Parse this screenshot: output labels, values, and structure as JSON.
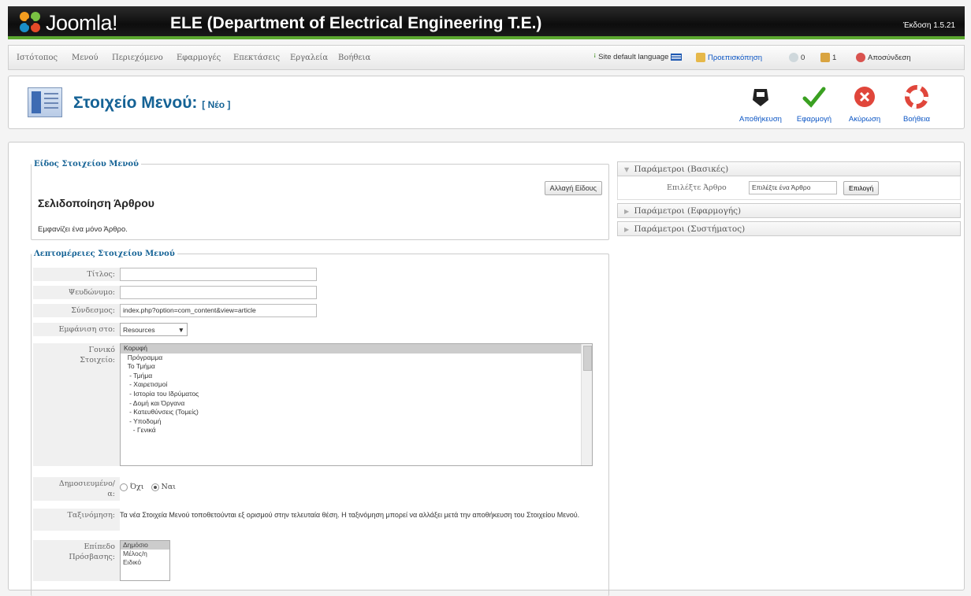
{
  "header": {
    "logo_text": "Joomla!",
    "site_title": "ELE (Department of Electrical Engineering T.E.)",
    "version": "Έκδοση 1.5.21"
  },
  "menu": {
    "items": [
      "Ιστότοπος",
      "Μενού",
      "Περιεχόμενο",
      "Εφαρμογές",
      "Επεκτάσεις",
      "Εργαλεία",
      "Βοήθεια"
    ],
    "site_default_language": "Site default language",
    "preview": "Προεπισκόπηση",
    "messages_count": "0",
    "users_count": "1",
    "logout": "Αποσύνδεση"
  },
  "toolbar": {
    "title": "Στοιχείο Μενού:",
    "subtitle": "[ Νέο ]",
    "save": "Αποθήκευση",
    "apply": "Εφαρμογή",
    "cancel": "Ακύρωση",
    "help": "Βοήθεια"
  },
  "type_box": {
    "legend": "Είδος Στοιχείου Μενού",
    "name": "Σελιδοποίηση Άρθρου",
    "description": "Εμφανίζει ένα μόνο Άρθρο.",
    "change_button": "Αλλαγή Είδους"
  },
  "details": {
    "legend": "Λεπτομέρειες Στοιχείου Μενού",
    "title_label": "Τίτλος:",
    "title_value": "",
    "alias_label": "Ψευδώνυμο:",
    "alias_value": "",
    "link_label": "Σύνδεσμος:",
    "link_value": "index.php?option=com_content&view=article",
    "display_in_label": "Εμφάνιση στο:",
    "display_in_value": "Resources",
    "parent_label_1": "Γονικό",
    "parent_label_2": "Στοιχείο:",
    "parent_items": [
      "Κορυφή",
      "  Πρόγραμμα",
      "  Το Τμήμα",
      "   - Τμήμα",
      "   - Χαιρετισμοί",
      "   - Ιστορία του Ιδρύματος",
      "   - Δομή και Όργανα",
      "   - Κατευθύνσεις (Τομείς)",
      "   - Υποδομή",
      "     - Γενικά"
    ],
    "published_label_1": "Δημοσιευμένο/",
    "published_label_2": "α:",
    "published_no": "Όχι",
    "published_yes": "Ναι",
    "order_label": "Ταξινόμηση:",
    "order_text": "Τα νέα Στοιχεία Μενού τοποθετούνται εξ ορισμού στην τελευταία θέση. Η ταξινόμηση μπορεί να αλλάξει μετά την αποθήκευση του Στοιχείου Μενού.",
    "access_label_1": "Επίπεδο",
    "access_label_2": "Πρόσβασης:",
    "access_items": [
      "Δημόσιο",
      "Μέλος/η",
      "Ειδικό"
    ]
  },
  "params": {
    "basic": "Παράμετροι (Βασικές)",
    "select_article_label": "Επιλέξτε Άρθρο",
    "select_article_value": "Επιλέξτε ένα Άρθρο",
    "select_button": "Επιλογή",
    "component": "Παράμετροι (Εφαρμογής)",
    "system": "Παράμετροι (Συστήματος)"
  },
  "colors": {
    "brand_green": "#5ca830",
    "heading_blue": "#146295",
    "link_blue": "#0b55c4"
  }
}
